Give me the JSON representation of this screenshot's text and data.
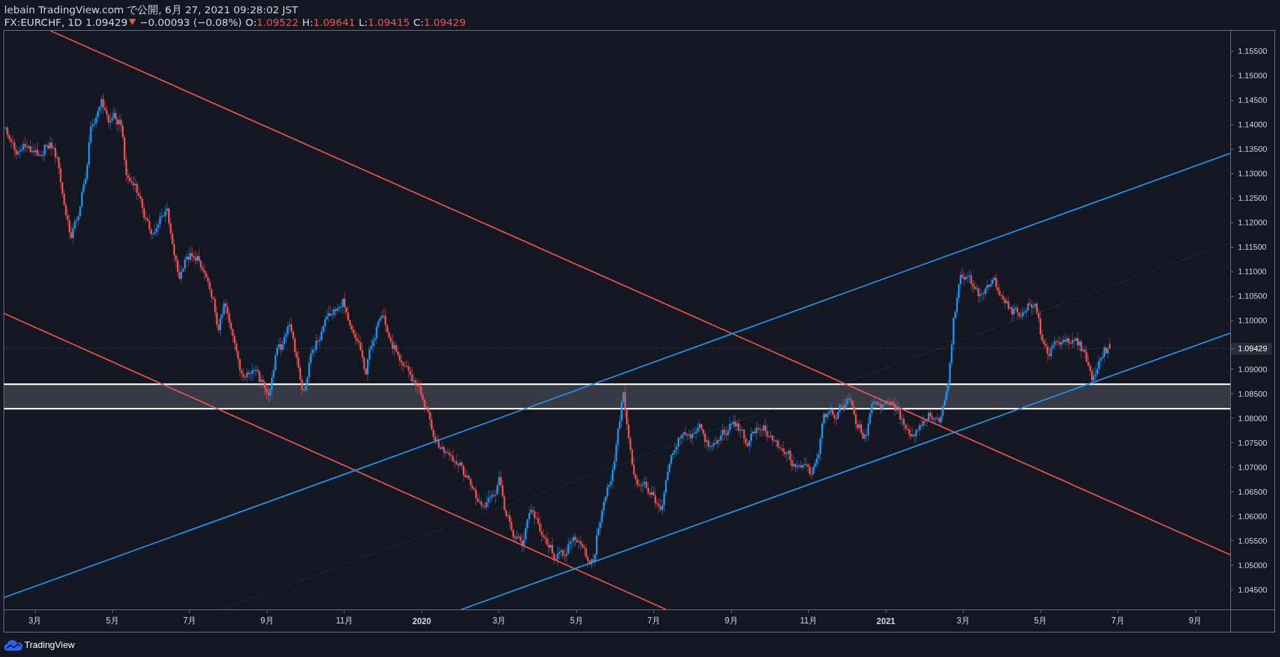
{
  "header": {
    "publish_info": "lebain TradingView.com で公開, 6月 27, 2021 09:28:02 JST",
    "symbol": "FX:EURCHF, 1D",
    "last": "1.09429",
    "down": true,
    "change": "−0.00093 (−0.08%)",
    "ohlc": [
      {
        "label": "O:",
        "value": "1.09522"
      },
      {
        "label": "H:",
        "value": "1.09641"
      },
      {
        "label": "L:",
        "value": "1.09415"
      },
      {
        "label": "C:",
        "value": "1.09429"
      }
    ]
  },
  "price_axis": [
    {
      "kind": "tick",
      "label": "1.15500"
    },
    {
      "kind": "tick",
      "label": "1.15000"
    },
    {
      "kind": "tick",
      "label": "1.14500"
    },
    {
      "kind": "tick",
      "label": "1.14000"
    },
    {
      "kind": "tick",
      "label": "1.13500"
    },
    {
      "kind": "tick",
      "label": "1.13000"
    },
    {
      "kind": "tick",
      "label": "1.12500"
    },
    {
      "kind": "tick",
      "label": "1.12000"
    },
    {
      "kind": "tick",
      "label": "1.11500"
    },
    {
      "kind": "tick",
      "label": "1.11000"
    },
    {
      "kind": "tick",
      "label": "1.10500"
    },
    {
      "kind": "tick",
      "label": "1.10000"
    },
    {
      "kind": "last_price",
      "label": "1.09429"
    },
    {
      "kind": "tick",
      "label": "1.09000"
    },
    {
      "kind": "tick",
      "label": "1.08500"
    },
    {
      "kind": "tick",
      "label": "1.08000"
    },
    {
      "kind": "tick",
      "label": "1.07500"
    },
    {
      "kind": "tick",
      "label": "1.07000"
    },
    {
      "kind": "tick",
      "label": "1.06500"
    },
    {
      "kind": "tick",
      "label": "1.06000"
    },
    {
      "kind": "tick",
      "label": "1.05500"
    },
    {
      "kind": "tick",
      "label": "1.05000"
    },
    {
      "kind": "tick",
      "label": "1.04500"
    }
  ],
  "time_axis": [
    {
      "kind": "month",
      "label": "3月"
    },
    {
      "kind": "month",
      "label": "5月"
    },
    {
      "kind": "month",
      "label": "7月"
    },
    {
      "kind": "month",
      "label": "9月"
    },
    {
      "kind": "month",
      "label": "11月"
    },
    {
      "kind": "year",
      "label": "2020"
    },
    {
      "kind": "month",
      "label": "3月"
    },
    {
      "kind": "month",
      "label": "5月"
    },
    {
      "kind": "month",
      "label": "7月"
    },
    {
      "kind": "month",
      "label": "9月"
    },
    {
      "kind": "month",
      "label": "11月"
    },
    {
      "kind": "year",
      "label": "2021"
    },
    {
      "kind": "month",
      "label": "3月"
    },
    {
      "kind": "month",
      "label": "5月"
    },
    {
      "kind": "month",
      "label": "7月"
    },
    {
      "kind": "month",
      "label": "9月"
    }
  ],
  "footer": {
    "brand": "TradingView"
  }
}
